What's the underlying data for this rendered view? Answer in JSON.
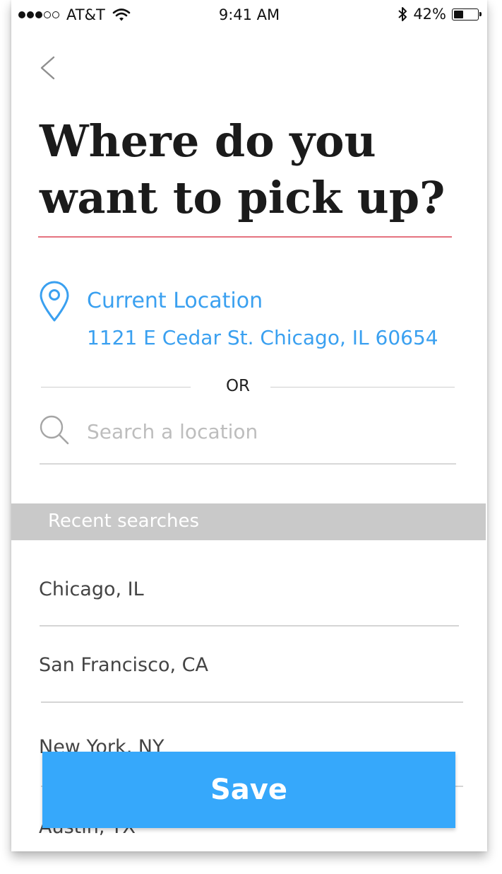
{
  "status_bar": {
    "carrier": "AT&T",
    "time": "9:41 AM",
    "battery": "42%",
    "battery_level": 0.42
  },
  "nav": {
    "back_icon": "chevron-left-icon"
  },
  "page": {
    "title_line1": "Where do you",
    "title_line2": "want to pick up?"
  },
  "current_location": {
    "icon": "location-pin-icon",
    "label": "Current Location",
    "address": "1121 E Cedar St. Chicago, IL 60654"
  },
  "divider_text": "OR",
  "search": {
    "icon": "search-icon",
    "placeholder": "Search a location",
    "value": ""
  },
  "recent": {
    "header": "Recent searches",
    "items": [
      {
        "label": "Chicago, IL"
      },
      {
        "label": "San Francisco, CA"
      },
      {
        "label": "New York, NY"
      },
      {
        "label": "Austin, TX"
      }
    ]
  },
  "actions": {
    "save_label": "Save"
  },
  "colors": {
    "accent": "#3aa0f0",
    "button": "#36a8fb",
    "title_underline": "#e57380",
    "section_header": "#c9c9c9"
  }
}
